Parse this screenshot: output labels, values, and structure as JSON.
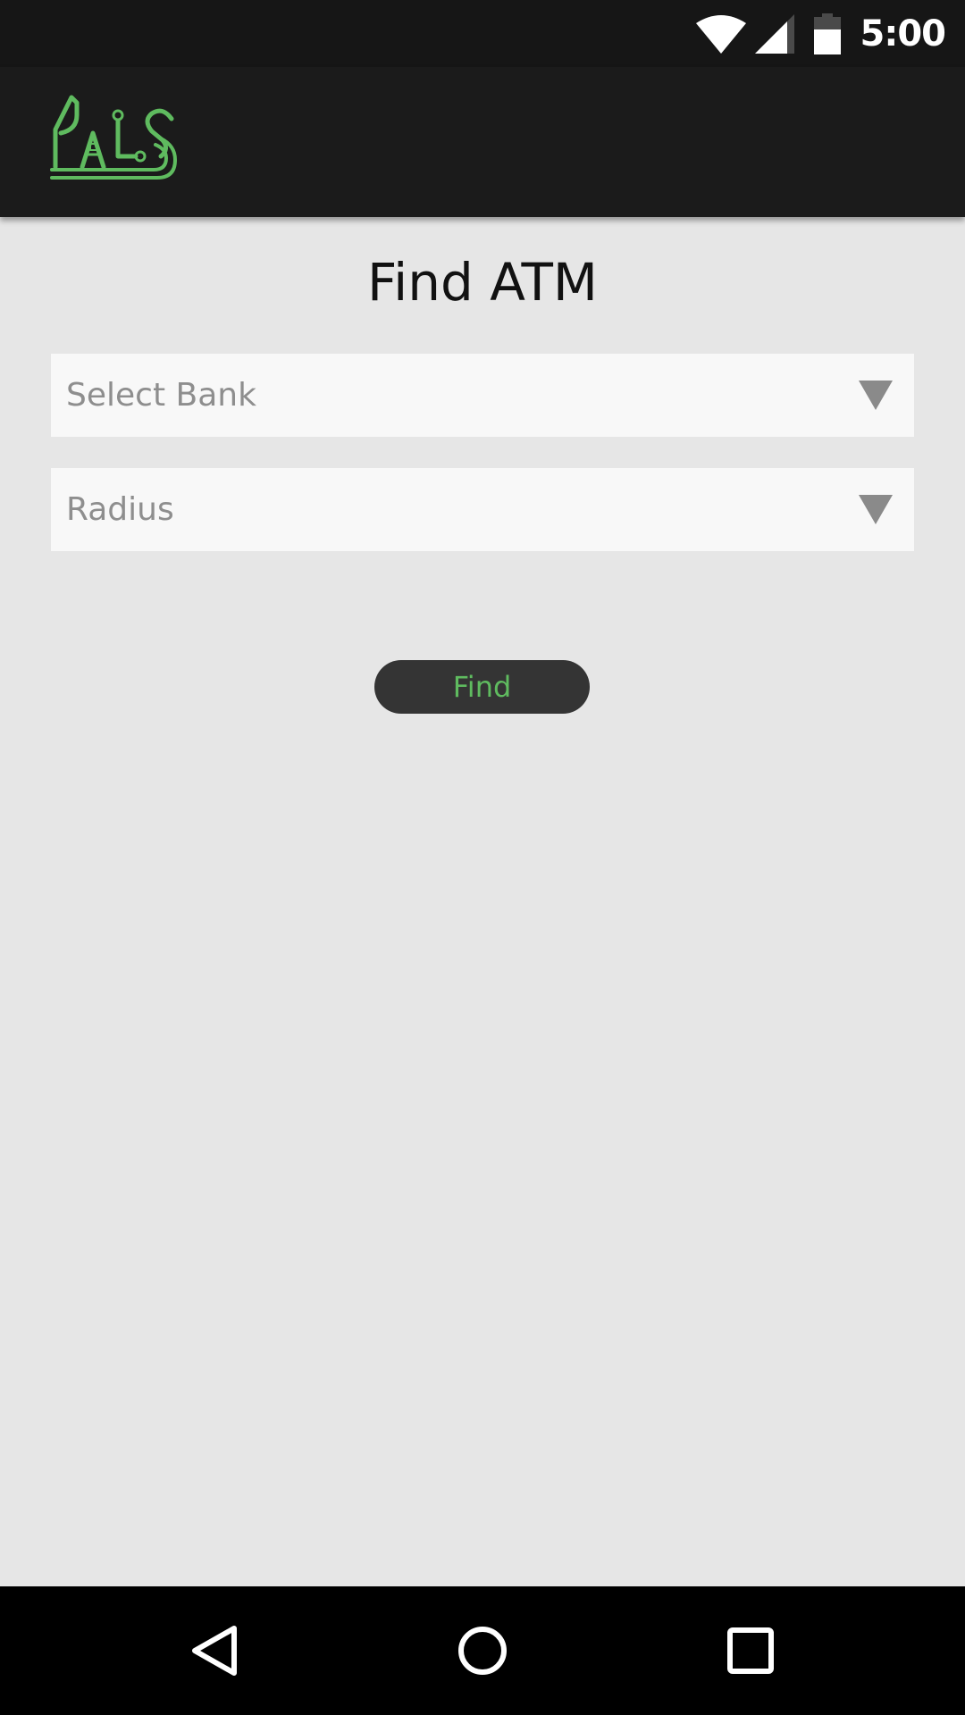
{
  "status_bar": {
    "time": "5:00",
    "icons": [
      "wifi-icon",
      "signal-icon",
      "battery-icon"
    ]
  },
  "app_bar": {
    "logo_icon": "pals-logo-icon",
    "logo_text": "PALS"
  },
  "page": {
    "title": "Find ATM"
  },
  "form": {
    "bank_select": {
      "value": "Select Bank",
      "icon": "dropdown-arrow-icon"
    },
    "radius_select": {
      "value": "Radius",
      "icon": "dropdown-arrow-icon"
    },
    "find_button_label": "Find"
  },
  "nav_bar": {
    "items": [
      "back-icon",
      "home-icon",
      "recent-apps-icon"
    ]
  },
  "colors": {
    "accent": "#5fbb5f",
    "status_bar": "#161616",
    "app_bar": "#1b1b1b",
    "background": "#e6e6e6",
    "field_background": "#f8f8f8",
    "button_background": "#343434",
    "placeholder_text": "#8e8e8e"
  }
}
